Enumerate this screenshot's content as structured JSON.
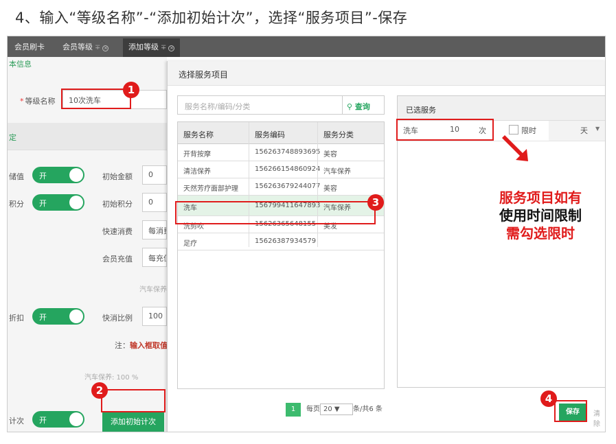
{
  "heading": "4、输入“等级名称”-“添加初始计次”，选择“服务项目”-保存",
  "tabs": [
    {
      "label": "会员刷卡"
    },
    {
      "label": "会员等级",
      "pin": "∓",
      "close": "×"
    },
    {
      "label": "添加等级",
      "pin": "∓",
      "close": "×"
    }
  ],
  "form": {
    "section_basic": "本信息",
    "level_name_label": "等级名称",
    "level_name_value": "10次洗车",
    "section_settings": "定",
    "stored_value_label": "储值",
    "stored_toggle": "开",
    "initial_amount_label": "初始金额",
    "initial_amount_value": "0",
    "points_label": "积分",
    "points_toggle": "开",
    "initial_points_label": "初始积分",
    "initial_points_value": "0",
    "quick_consume_label": "快速消费",
    "quick_consume_value": "每消费",
    "member_recharge_label": "会员充值",
    "member_recharge_value": "每充值",
    "faint_service": "汽车保养",
    "discount_label": "折扣",
    "discount_toggle": "开",
    "quick_ratio_label": "快消比例",
    "quick_ratio_value": "100",
    "note_prefix": "注：",
    "note_strong": "输入框取值",
    "faint_ratio": "汽车保养: 100  %",
    "count_label": "计次",
    "count_toggle": "开",
    "add_initial_count_button": "添加初始计次"
  },
  "modal": {
    "title": "选择服务项目",
    "search_placeholder": "服务名称/编码/分类",
    "search_button": "查询",
    "columns": [
      "服务名称",
      "服务编码",
      "服务分类"
    ],
    "rows": [
      {
        "name": "开背按摩",
        "code": "156263748893695",
        "category": "美容"
      },
      {
        "name": "清洁保养",
        "code": "156266154860924",
        "category": "汽车保养"
      },
      {
        "name": "天然芳疗面部护理",
        "code": "156263679244077",
        "category": "美容"
      },
      {
        "name": "洗车",
        "code": "156799411647893",
        "category": "汽车保养"
      },
      {
        "name": "洗剪吹",
        "code": "15626365648155",
        "category": "美发"
      },
      {
        "name": "足疗",
        "code": "15626387934579",
        "category": ""
      }
    ],
    "pager": {
      "page": "1",
      "per_page_label": "每页",
      "per_page_value": "20",
      "total": "条/共6 条"
    },
    "chosen_title": "已选服务",
    "chosen_item": {
      "name": "洗车",
      "count": "10",
      "unit": "次",
      "limit_label": "限时",
      "period_unit": "天"
    },
    "save_button": "保存",
    "clear_button": "清除"
  },
  "annotations": {
    "steps": [
      "1",
      "2",
      "3",
      "4"
    ],
    "callout_lines": [
      "服务项目如有",
      "使用时间限制",
      "需勾选限时"
    ],
    "accent_color": "#e01b1b",
    "brand_color": "#25a55f"
  }
}
